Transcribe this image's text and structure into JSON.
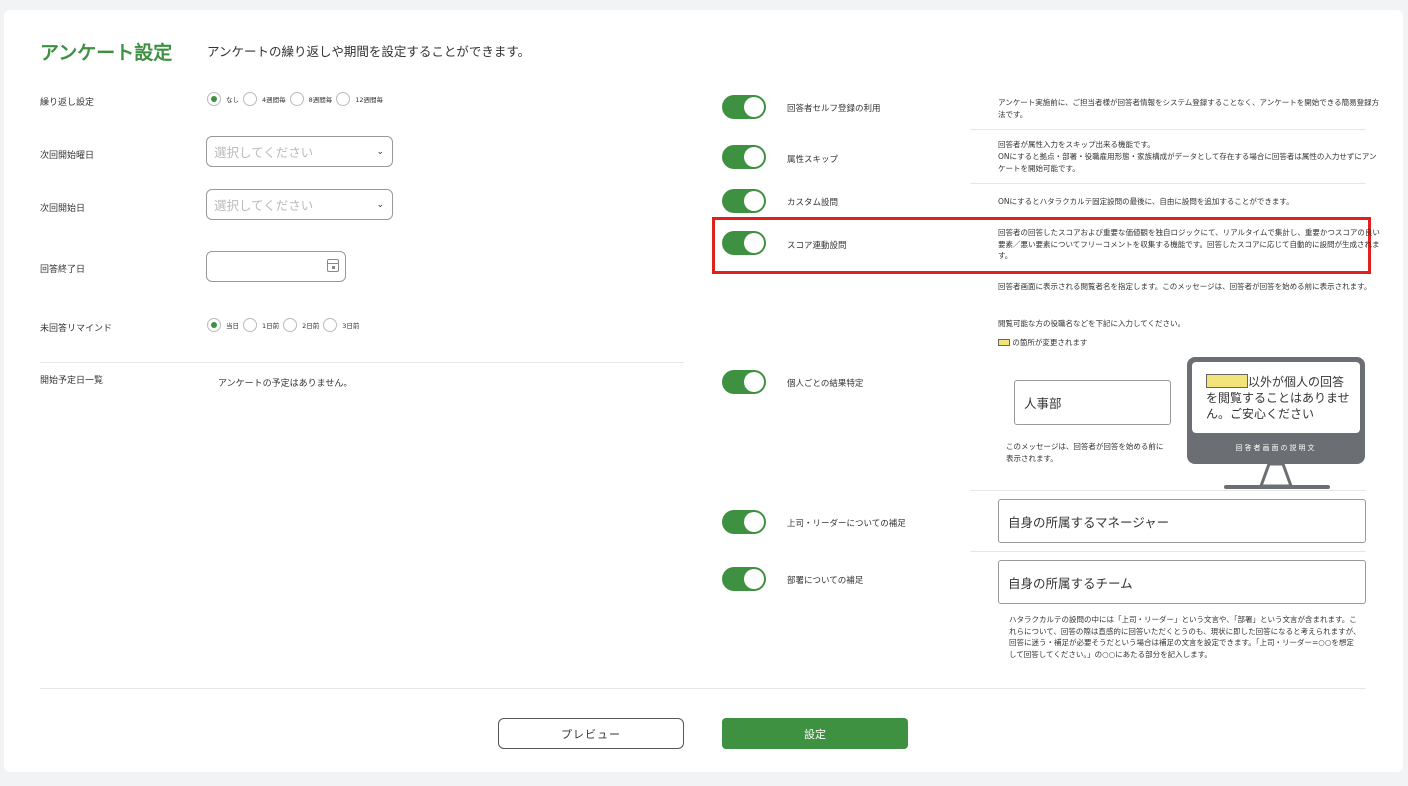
{
  "header": {
    "title": "アンケート設定",
    "subtitle": "アンケートの繰り返しや期間を設定することができます。"
  },
  "left": {
    "repeat": {
      "label": "繰り返し設定",
      "options": [
        "なし",
        "4週間毎",
        "8週間毎",
        "12週間毎"
      ],
      "selected": "なし"
    },
    "next_weekday": {
      "label": "次回開始曜日",
      "placeholder": "選択してください"
    },
    "next_start": {
      "label": "次回開始日",
      "placeholder": "選択してください"
    },
    "end_date": {
      "label": "回答終了日",
      "value": ""
    },
    "reminder": {
      "label": "未回答リマインド",
      "options": [
        "当日",
        "1日前",
        "2日前",
        "3日前"
      ],
      "selected": "当日"
    },
    "schedule": {
      "label": "開始予定日一覧",
      "empty_text": "アンケートの予定はありません。"
    }
  },
  "right": {
    "self_register": {
      "label": "回答者セルフ登録の利用",
      "enabled": true,
      "desc": "アンケート実施前に、ご担当者様が回答者情報をシステム登録することなく、アンケートを開始できる簡易登録方法です。"
    },
    "skip_attr": {
      "label": "属性スキップ",
      "enabled": true,
      "desc1": "回答者が属性入力をスキップ出来る機能です。",
      "desc2": "ONにすると拠点・部署・役職雇用形態・家族構成がデータとして存在する場合に回答者は属性の入力せずにアンケートを開始可能です。"
    },
    "custom_q": {
      "label": "カスタム設問",
      "enabled": true,
      "desc": "ONにするとハタラクカルテ固定設問の最後に、自由に設問を追加することができます。"
    },
    "score_q": {
      "label": "スコア連動設問",
      "enabled": true,
      "desc": "回答者の回答したスコアおよび重要な価値観を独自ロジックにて、リアルタイムで集計し、重要かつスコアの良い要素／悪い要素についてフリーコメントを収集する機能です。回答したスコアに応じて自動的に設問が生成されます。"
    },
    "individual": {
      "label": "個人ごとの結果特定",
      "enabled": true,
      "desc1": "回答者画面に表示される閲覧者名を指定します。このメッセージは、回答者が回答を始める前に表示されます。",
      "desc2": "閲覧可能な方の役職名などを下記に入力してください。",
      "legend": "の箇所が変更されます",
      "input_value": "人事部",
      "note": "このメッセージは、回答者が回答を始める前に表示されます。",
      "preview_text": "以外が個人の回答を閲覧することはありません。ご安心ください",
      "preview_caption": "回答者画面の説明文"
    },
    "boss": {
      "label": "上司・リーダーについての補足",
      "enabled": true,
      "value": "自身の所属するマネージャー"
    },
    "dept": {
      "label": "部署についての補足",
      "enabled": true,
      "value": "自身の所属するチーム",
      "desc": "ハタラクカルテの設問の中には「上司・リーダー」という文言や、「部署」という文言が含まれます。これらについて、回答の際は直感的に回答いただくとうのも、現状に即した回答になると考えられますが、回答に迷う・補足が必要そうだという場合は補足の文言を設定できます。「上司・リーダー=○○を想定して回答してください。」の○○にあたる部分を記入します。"
    }
  },
  "footer": {
    "preview_label": "プレビュー",
    "submit_label": "設定"
  },
  "colors": {
    "accent": "#3d9140",
    "highlight": "#f2e37a",
    "alert": "#e0201b"
  }
}
